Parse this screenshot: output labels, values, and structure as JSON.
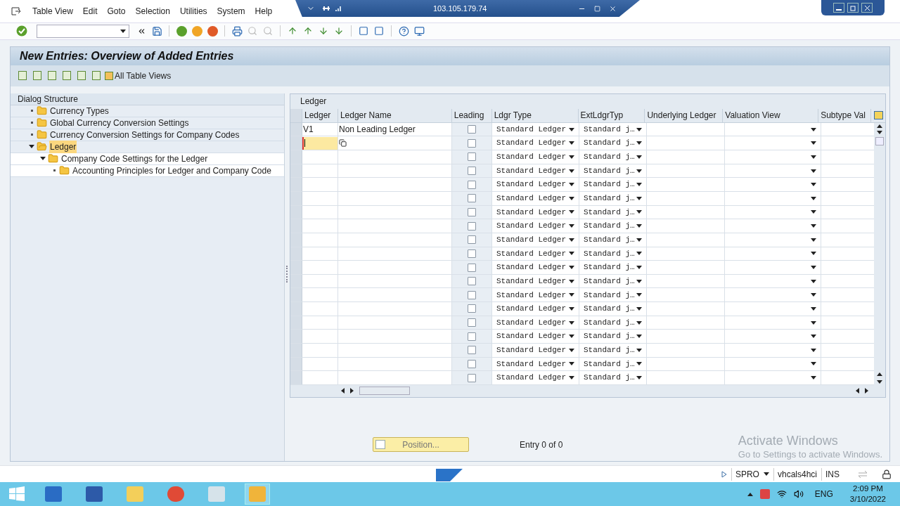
{
  "remote_session": {
    "title": "103.105.179.74"
  },
  "menu": [
    "Table View",
    "Edit",
    "Goto",
    "Selection",
    "Utilities",
    "System",
    "Help"
  ],
  "title": "New Entries: Overview of Added Entries",
  "app_toolbar": {
    "all_views_label": "All Table Views"
  },
  "dialog_structure": {
    "title": "Dialog Structure",
    "items": [
      {
        "label": "Currency Types",
        "expanded": false,
        "selected": false
      },
      {
        "label": "Global Currency Conversion Settings",
        "expanded": false,
        "selected": false
      },
      {
        "label": "Currency Conversion Settings for Company Codes",
        "expanded": false,
        "selected": false
      },
      {
        "label": "Ledger",
        "expanded": true,
        "selected": true,
        "children": [
          {
            "label": "Company Code Settings for the Ledger",
            "expanded": true,
            "selected": false,
            "children": [
              {
                "label": "Accounting Principles for Ledger and Company Code",
                "expanded": false,
                "selected": false
              }
            ]
          }
        ]
      }
    ]
  },
  "table": {
    "title": "Ledger",
    "columns": [
      "Ledger",
      "Ledger Name",
      "Leading",
      "Ldgr Type",
      "ExtLdgrTyp",
      "Underlying Ledger",
      "Valuation View",
      "Subtype Val"
    ],
    "rows": [
      {
        "ledger": "V1",
        "ledger_name": "Non Leading Ledger",
        "leading": false,
        "ldgr_type": "Standard Ledger",
        "ext_type": "Standard j…",
        "active": false
      },
      {
        "leading": false,
        "ldgr_type": "Standard Ledger",
        "ext_type": "Standard j…",
        "active": true
      },
      {
        "leading": false,
        "ldgr_type": "Standard Ledger",
        "ext_type": "Standard j…",
        "active": false
      },
      {
        "leading": false,
        "ldgr_type": "Standard Ledger",
        "ext_type": "Standard j…",
        "active": false
      },
      {
        "leading": false,
        "ldgr_type": "Standard Ledger",
        "ext_type": "Standard j…",
        "active": false
      },
      {
        "leading": false,
        "ldgr_type": "Standard Ledger",
        "ext_type": "Standard j…",
        "active": false
      },
      {
        "leading": false,
        "ldgr_type": "Standard Ledger",
        "ext_type": "Standard j…",
        "active": false
      },
      {
        "leading": false,
        "ldgr_type": "Standard Ledger",
        "ext_type": "Standard j…",
        "active": false
      },
      {
        "leading": false,
        "ldgr_type": "Standard Ledger",
        "ext_type": "Standard j…",
        "active": false
      },
      {
        "leading": false,
        "ldgr_type": "Standard Ledger",
        "ext_type": "Standard j…",
        "active": false
      },
      {
        "leading": false,
        "ldgr_type": "Standard Ledger",
        "ext_type": "Standard j…",
        "active": false
      },
      {
        "leading": false,
        "ldgr_type": "Standard Ledger",
        "ext_type": "Standard j…",
        "active": false
      },
      {
        "leading": false,
        "ldgr_type": "Standard Ledger",
        "ext_type": "Standard j…",
        "active": false
      },
      {
        "leading": false,
        "ldgr_type": "Standard Ledger",
        "ext_type": "Standard j…",
        "active": false
      },
      {
        "leading": false,
        "ldgr_type": "Standard Ledger",
        "ext_type": "Standard j…",
        "active": false
      },
      {
        "leading": false,
        "ldgr_type": "Standard Ledger",
        "ext_type": "Standard j…",
        "active": false
      },
      {
        "leading": false,
        "ldgr_type": "Standard Ledger",
        "ext_type": "Standard j…",
        "active": false
      },
      {
        "leading": false,
        "ldgr_type": "Standard Ledger",
        "ext_type": "Standard j…",
        "active": false
      },
      {
        "leading": false,
        "ldgr_type": "Standard Ledger",
        "ext_type": "Standard j…",
        "active": false
      }
    ]
  },
  "position_button": "Position...",
  "entry_info": "Entry 0 of 0",
  "activation_notice": {
    "title": "Activate Windows",
    "subtitle": "Go to Settings to activate Windows."
  },
  "status_bar": {
    "transaction": "SPRO",
    "server": "vhcals4hci",
    "mode": "INS"
  },
  "taskbar": {
    "language": "ENG",
    "time": "2:09 PM",
    "date": "3/10/2022"
  }
}
